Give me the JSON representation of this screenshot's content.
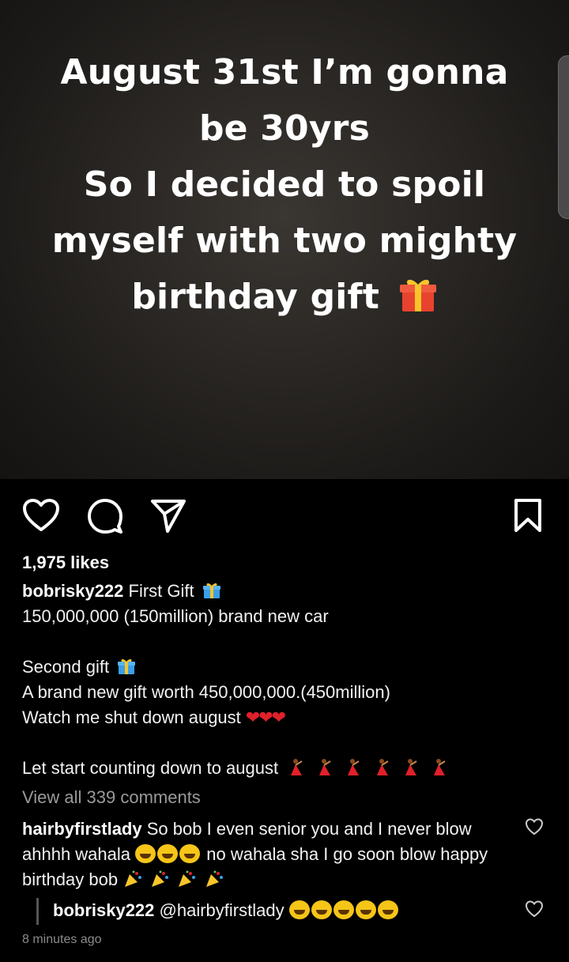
{
  "story": {
    "lines": [
      "August 31st I’m gonna",
      "be 30yrs",
      "So I decided to spoil",
      "myself with two mighty",
      "birthday gift"
    ]
  },
  "actions": {
    "like_icon": "heart-outline-icon",
    "comment_icon": "comment-bubble-icon",
    "share_icon": "send-paper-plane-icon",
    "save_icon": "bookmark-icon"
  },
  "post": {
    "likes": "1,975 likes",
    "username": "bobrisky222",
    "caption_first": "First Gift",
    "caption_lines": [
      "150,000,000 (150million) brand new car",
      "Second gift",
      "A brand new gift worth 450,000,000.(450million)",
      "Watch me shut down august",
      "Let start counting down to august"
    ],
    "view_all_comments": "View all 339 comments"
  },
  "comments": [
    {
      "username": "hairbyfirstlady",
      "text_part1": "So bob I even senior you and I never blow ahhhh wahala",
      "text_part2": "no wahala sha I go soon blow happy birthday bob"
    }
  ],
  "reply": {
    "username": "bobrisky222",
    "mention": "@hairbyfirstlady"
  },
  "timestamp": "8 minutes ago",
  "colors": {
    "background": "#000000",
    "muted_text": "#9a9a9a",
    "heart_red": "#e0202a",
    "gift_red": "#e8432e",
    "gift_blue": "#3a9ee8"
  }
}
